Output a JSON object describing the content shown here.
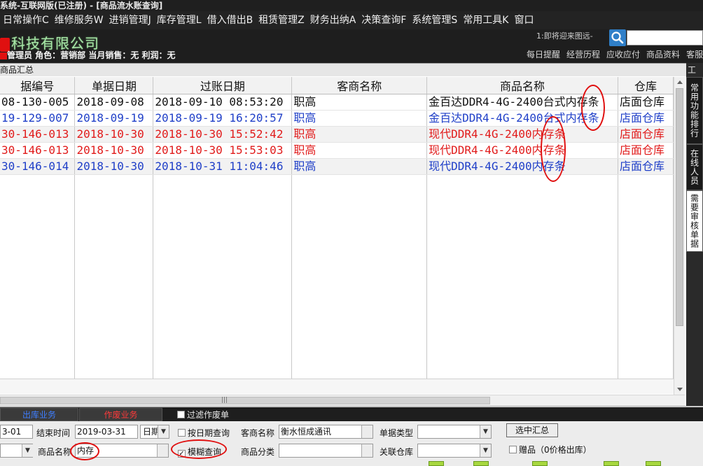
{
  "window": {
    "title": "系统-互联网版(已注册) - [商品流水账查询]"
  },
  "menu": [
    "日常操作C",
    "维修服务W",
    "进销管理J",
    "库存管理L",
    "借入借出B",
    "租赁管理Z",
    "财务出纳A",
    "决策查询F",
    "系统管理S",
    "常用工具K",
    "窗口"
  ],
  "header": {
    "company": "科技有限公司",
    "user_line": "管理员  角色：营销部  当月销售：无  利润：无",
    "search_hint": "1:即将迎来图远-",
    "quick_links": [
      "每日提醒",
      "经营历程",
      "应收应付",
      "商品资料",
      "客服"
    ]
  },
  "panel": {
    "title": "商品汇总",
    "tool_tab": "工具"
  },
  "table": {
    "columns": [
      "据编号",
      "单据日期",
      "过账日期",
      "客商名称",
      "商品名称",
      "仓库"
    ],
    "rows": [
      {
        "color": "black",
        "cells": [
          "08-130-005",
          "2018-09-08",
          "2018-09-10  08:53:20",
          "职高",
          "金百达DDR4-4G-2400台式内存条",
          "店面仓库"
        ]
      },
      {
        "color": "blue",
        "cells": [
          "19-129-007",
          "2018-09-19",
          "2018-09-19  16:20:57",
          "职高",
          "金百达DDR4-4G-2400台式内存条",
          "店面仓库"
        ]
      },
      {
        "color": "red",
        "cells": [
          "30-146-013",
          "2018-10-30",
          "2018-10-30  15:52:42",
          "职高",
          "现代DDR4-4G-2400内存条",
          "店面仓库"
        ]
      },
      {
        "color": "red",
        "cells": [
          "30-146-013",
          "2018-10-30",
          "2018-10-30  15:53:03",
          "职高",
          "现代DDR4-4G-2400内存条",
          "店面仓库"
        ]
      },
      {
        "color": "blue",
        "cells": [
          "30-146-014",
          "2018-10-30",
          "2018-10-31  11:04:46",
          "职高",
          "现代DDR4-4G-2400内存条",
          "店面仓库"
        ]
      }
    ]
  },
  "right_tabs": [
    "常用功能排行",
    "在线人员",
    "需要审核单据"
  ],
  "bottom": {
    "tabs": {
      "out": "出库业务",
      "void": "作废业务"
    },
    "filter_void": "过滤作废单",
    "start_date": "3-01",
    "end_label": "结束时间",
    "end_date": "2019-03-31",
    "date_mode": "日期",
    "by_date": "按日期查询",
    "client_label": "客商名称",
    "client_value": "衡水恒成通讯",
    "doctype_label": "单据类型",
    "summary_btn": "选中汇总",
    "product_label": "商品名称",
    "product_value": "内存",
    "fuzzy": "模糊查询",
    "category_label": "商品分类",
    "warehouse_label": "关联仓库",
    "gift": "赠品（0价格出库）"
  }
}
